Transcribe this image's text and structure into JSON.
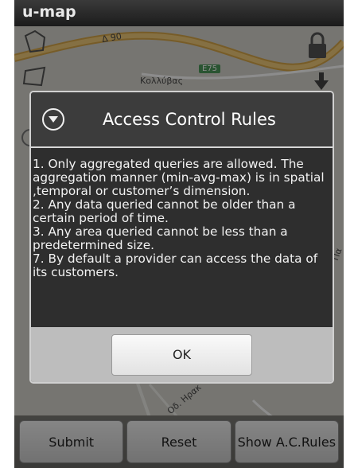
{
  "app": {
    "title": "u-map"
  },
  "map": {
    "labels": {
      "road_top": "Δ 90",
      "road_shield": "E75",
      "place": "Κολλύβας",
      "street_bottom": "Οδ. Ηρακ",
      "street_right": "Πα"
    }
  },
  "dialog": {
    "icon": "chevron-down-circle-icon",
    "title": "Access Control Rules",
    "body": "1. Only aggregated queries are allowed. The aggregation manner (min-avg-max) is in spatial ,temporal or customer’s dimension.\n 2. Any data queried cannot be older than a certain period of time.\n 3. Any area queried cannot be less than a predetermined size.\n 7. By default a provider can access the data of its customers.",
    "ok_label": "OK"
  },
  "bottom_buttons": {
    "submit": "Submit",
    "reset": "Reset",
    "show_rules": "Show A.C.Rules"
  },
  "colors": {
    "dialog_bg": "#2e2e2e",
    "dialog_header": "#3c3c3c",
    "footer_bg": "#bdbdbd",
    "road": "#e4b85a"
  }
}
